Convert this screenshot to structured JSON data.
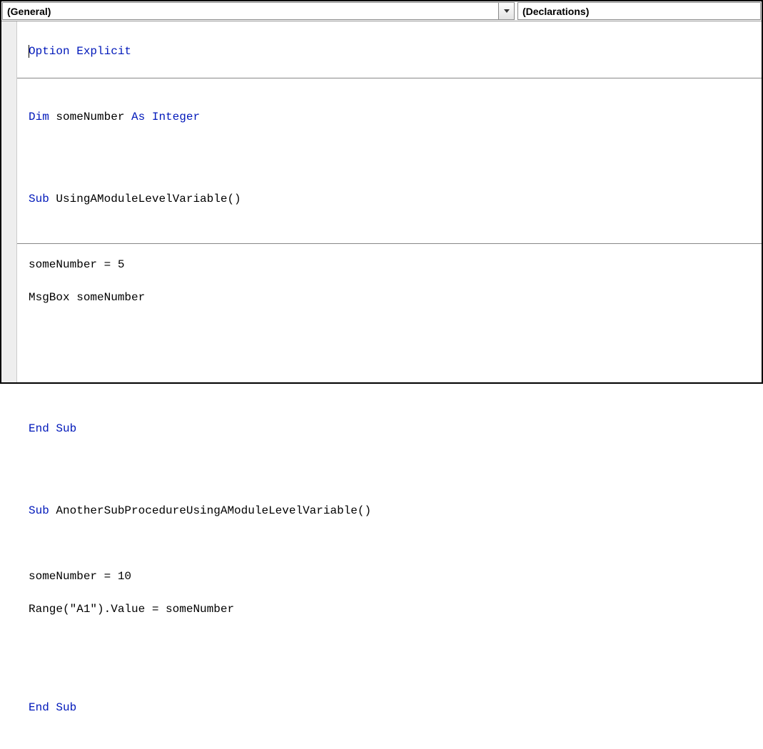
{
  "dropdowns": {
    "object": "(General)",
    "procedure": "(Declarations)"
  },
  "code": {
    "line01_kw1": "Option",
    "line01_kw2": "Explicit",
    "line02": "",
    "line03_kw1": "Dim",
    "line03_txt1": " someNumber ",
    "line03_kw2": "As",
    "line03_kw3": "Integer",
    "line05_kw1": "Sub",
    "line05_txt1": " UsingAModuleLevelVariable()",
    "line07_txt1": "someNumber = 5",
    "line08_txt1": "MsgBox someNumber",
    "line12_kw1": "End Sub",
    "line14_kw1": "Sub",
    "line14_txt1": " AnotherSubProcedureUsingAModuleLevelVariable()",
    "line16_txt1": "someNumber = 10",
    "line17_txt1": "Range(",
    "line17_str1": "\"A1\"",
    "line17_txt2": ").Value = someNumber",
    "line20_kw1": "End Sub"
  }
}
